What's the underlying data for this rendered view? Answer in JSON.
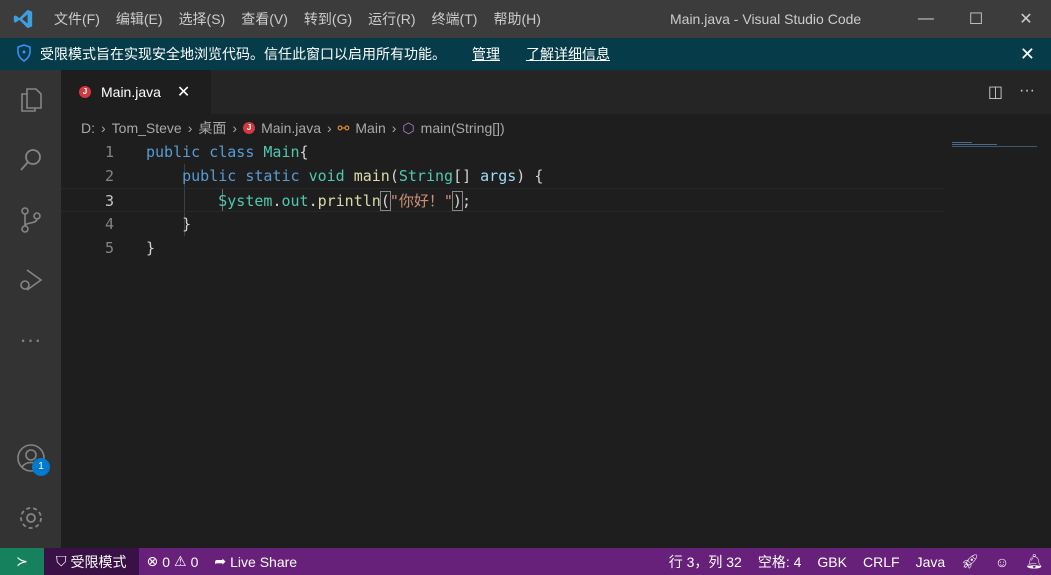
{
  "titlebar": {
    "menu": [
      "文件(F)",
      "编辑(E)",
      "选择(S)",
      "查看(V)",
      "转到(G)",
      "运行(R)",
      "终端(T)",
      "帮助(H)"
    ],
    "title": "Main.java - Visual Studio Code"
  },
  "banner": {
    "message": "受限模式旨在实现安全地浏览代码。信任此窗口以启用所有功能。",
    "manage": "管理",
    "learn_more": "了解详细信息"
  },
  "tab": {
    "label": "Main.java",
    "icon_letter": "J"
  },
  "breadcrumb": [
    "D:",
    "Tom_Steve",
    "桌面",
    "Main.java",
    "Main",
    "main(String[])"
  ],
  "activity": {
    "account_badge": "1"
  },
  "editor": {
    "line_numbers": [
      "1",
      "2",
      "3",
      "4",
      "5"
    ],
    "current_line": 3
  },
  "status": {
    "restricted": "受限模式",
    "errors": "0",
    "warnings": "0",
    "live_share": "Live Share",
    "position": "行 3，列 32",
    "spaces": "空格: 4",
    "encoding": "GBK",
    "eol": "CRLF",
    "language": "Java"
  },
  "colors": {
    "accent": "#007acc",
    "status": "#68217a",
    "banner": "#063b49"
  }
}
